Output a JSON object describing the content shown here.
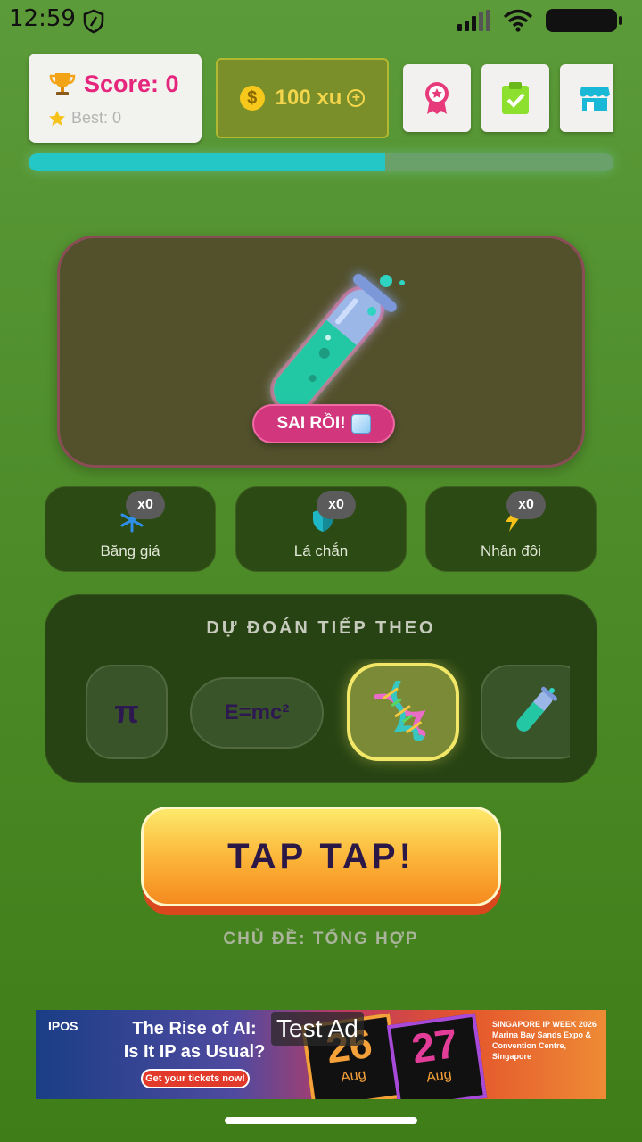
{
  "status_bar": {
    "time": "12:59"
  },
  "header": {
    "score_label": "Score: 0",
    "best_label": "Best: 0",
    "coins_label": "100 xu",
    "coin_symbol": "$",
    "coin_plus": "+",
    "progress": 0.61,
    "buttons": [
      "badge-icon",
      "clipboard-check-icon",
      "store-icon"
    ]
  },
  "game": {
    "feedback": "SAI RỒI!",
    "current_item": "test-tube-icon"
  },
  "powerups": [
    {
      "label": "Băng giá",
      "count": "x0",
      "icon": "snowflake-icon"
    },
    {
      "label": "Lá chắn",
      "count": "x0",
      "icon": "shield-icon"
    },
    {
      "label": "Nhân đôi",
      "count": "x0",
      "icon": "lightning-icon"
    }
  ],
  "predict": {
    "title": "DỰ ĐOÁN TIẾP THEO",
    "items": [
      {
        "text": "π"
      },
      {
        "text": "E=mc²"
      },
      {
        "icon": "dna-icon",
        "selected": true
      },
      {
        "icon": "test-tube-icon"
      }
    ]
  },
  "tap_button": "TAP TAP!",
  "topic": "CHỦ ĐỀ: TỔNG HỢP",
  "ad": {
    "logo": "IPOS",
    "headline_1": "The Rise of AI:",
    "headline_2": "Is It IP as Usual?",
    "cta": "Get your tickets now!",
    "tag": "Test Ad",
    "date1_day": "26",
    "date1_month": "Aug",
    "date2_day": "27",
    "date2_month": "Aug",
    "info": "SINGAPORE IP WEEK 2026 Marina Bay Sands Expo & Convention Centre, Singapore"
  },
  "colors": {
    "accent_pink": "#e5267c",
    "coin_gold": "#f3d54b",
    "progress_teal": "#24c6c6",
    "tap_orange": "#fbb236"
  }
}
